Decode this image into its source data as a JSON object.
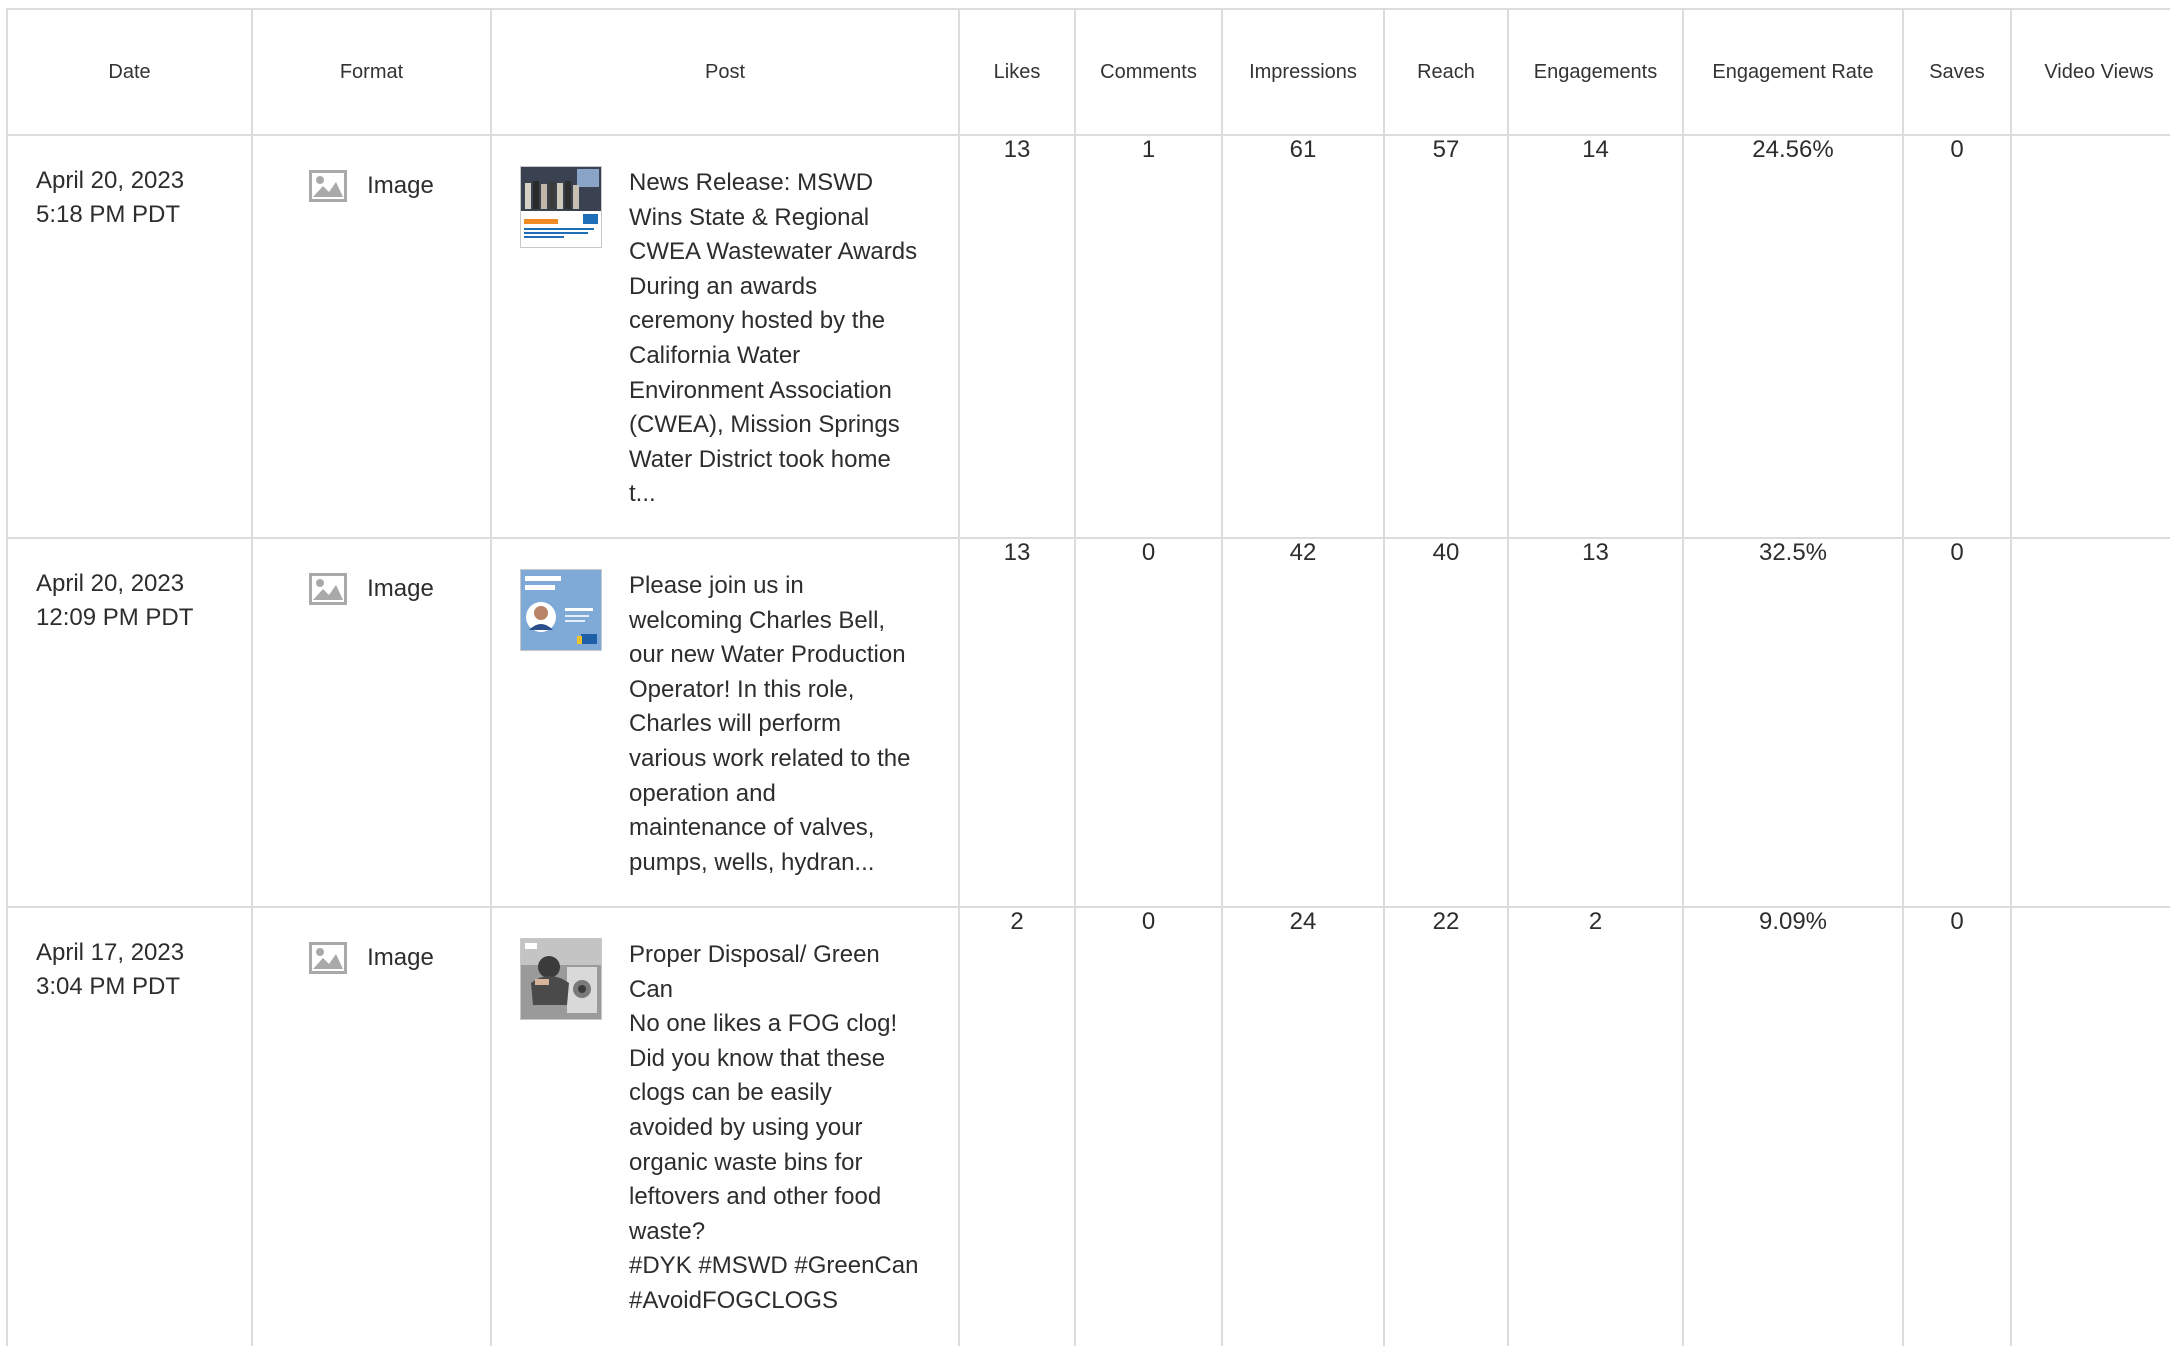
{
  "table": {
    "headers": {
      "date": "Date",
      "format": "Format",
      "post": "Post",
      "likes": "Likes",
      "comments": "Comments",
      "impressions": "Impressions",
      "reach": "Reach",
      "engagements": "Engagements",
      "engagement_rate": "Engagement Rate",
      "saves": "Saves",
      "video_views": "Video Views"
    },
    "rows": [
      {
        "date": "April 20, 2023",
        "time": "5:18 PM PDT",
        "format": "Image",
        "format_icon": "image-icon",
        "thumbnail": "news-release-photo",
        "post": "News Release: MSWD Wins State & Regional CWEA Wastewater Awards\nDuring an awards ceremony hosted by the California Water Environment Association (CWEA), Mission Springs Water District took home t...",
        "likes": "13",
        "comments": "1",
        "impressions": "61",
        "reach": "57",
        "engagements": "14",
        "engagement_rate": "24.56%",
        "saves": "0",
        "video_views": ""
      },
      {
        "date": "April 20, 2023",
        "time": "12:09 PM PDT",
        "format": "Image",
        "format_icon": "image-icon",
        "thumbnail": "welcome-to-our-team-photo",
        "post": "Please join us in welcoming Charles Bell, our new Water Production Operator! In this role, Charles will perform various work related to the operation and maintenance of valves, pumps, wells, hydran...",
        "likes": "13",
        "comments": "0",
        "impressions": "42",
        "reach": "40",
        "engagements": "13",
        "engagement_rate": "32.5%",
        "saves": "0",
        "video_views": ""
      },
      {
        "date": "April 17, 2023",
        "time": "3:04 PM PDT",
        "format": "Image",
        "format_icon": "image-icon",
        "thumbnail": "clogged-drain-photo",
        "post": "Proper Disposal/ Green Can\nNo one likes a FOG clog!\nDid you know that these clogs can be easily avoided by using your organic waste bins for leftovers and other food waste?\n#DYK #MSWD #GreenCan #AvoidFOGCLOGS",
        "likes": "2",
        "comments": "0",
        "impressions": "24",
        "reach": "22",
        "engagements": "2",
        "engagement_rate": "9.09%",
        "saves": "0",
        "video_views": ""
      }
    ]
  }
}
